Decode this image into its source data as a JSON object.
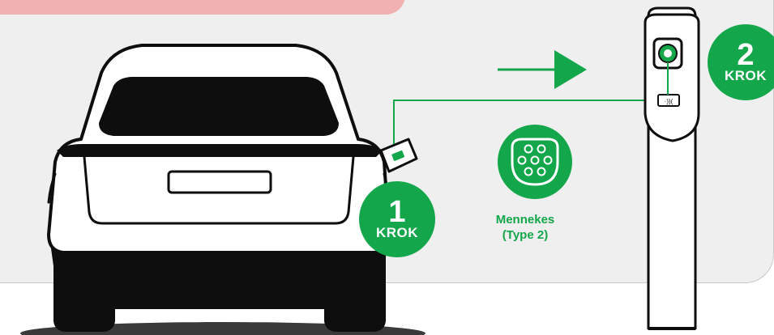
{
  "steps": [
    {
      "number": "1",
      "word": "KROK"
    },
    {
      "number": "2",
      "word": "KROK"
    }
  ],
  "connector": {
    "name_line1": "Mennekes",
    "name_line2": "(Type 2)",
    "icon": "type2-socket-icon"
  },
  "colors": {
    "accent_green": "#13a64b",
    "panel_gray": "#efefef",
    "header_pink": "#f2b1b1",
    "car_black": "#0e0e0e"
  }
}
